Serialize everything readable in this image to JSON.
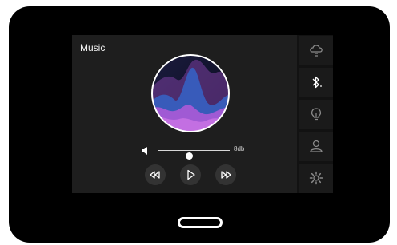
{
  "app": {
    "title": "Music"
  },
  "volume": {
    "level_label": "8db",
    "level_fraction": 0.43
  },
  "controls": {
    "rewind_icon": "rewind-icon",
    "play_icon": "play-icon",
    "fast_forward_icon": "fast-forward-icon"
  },
  "sidebar": {
    "items": [
      {
        "icon": "cloud-icon"
      },
      {
        "icon": "bluetooth-icon"
      },
      {
        "icon": "lightbulb-icon"
      },
      {
        "icon": "user-icon"
      },
      {
        "icon": "gear-icon"
      }
    ]
  },
  "colors": {
    "device": "#000000",
    "panel": "#1e1e1e",
    "accent_purple": "#b35bd8",
    "accent_blue": "#3f6fd1"
  }
}
